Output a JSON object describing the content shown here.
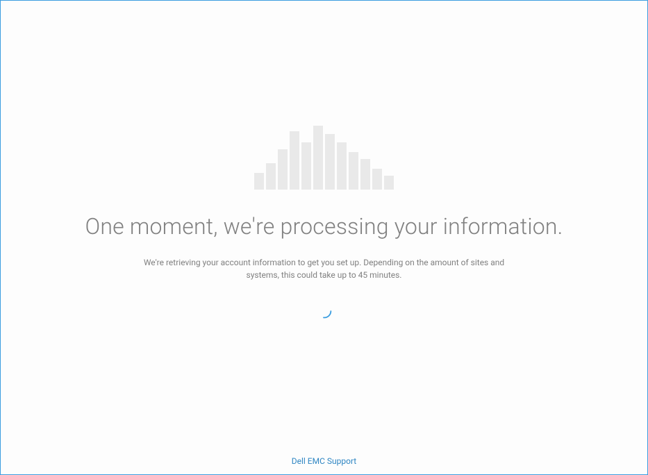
{
  "loading": {
    "heading": "One moment, we're processing your information.",
    "subtext": "We're retrieving your account information to get you set up. Depending on the amount of sites and systems, this could take up to 45 minutes."
  },
  "footer": {
    "support_link": "Dell EMC Support"
  },
  "cloud_bars": [
    24,
    38,
    58,
    84,
    68,
    92,
    80,
    68,
    54,
    44,
    30,
    20
  ],
  "colors": {
    "border": "#3b9de0",
    "bar_fill": "#e9e9e9",
    "text_primary": "#808080",
    "link": "#2f86c3",
    "spinner": "#3b9de0"
  }
}
